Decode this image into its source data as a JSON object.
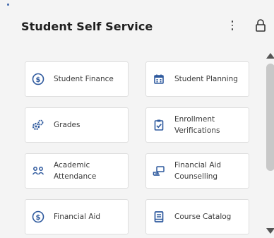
{
  "header": {
    "title": "Student Self Service",
    "menu_icon": "kebab-menu-icon",
    "lock_icon": "lock-icon"
  },
  "tiles": [
    {
      "label": "Student Finance",
      "icon": "dollar-circle-icon"
    },
    {
      "label": "Student Planning",
      "icon": "calendar-icon"
    },
    {
      "label": "Grades",
      "icon": "gears-icon"
    },
    {
      "label": "Enrollment Verifications",
      "icon": "clipboard-check-icon"
    },
    {
      "label": "Academic Attendance",
      "icon": "people-icon"
    },
    {
      "label": "Financial Aid Counselling",
      "icon": "chat-hand-icon"
    },
    {
      "label": "Financial Aid",
      "icon": "dollar-circle-icon"
    },
    {
      "label": "Course Catalog",
      "icon": "book-icon"
    }
  ],
  "colors": {
    "accent": "#2f5a9e",
    "background": "#f4f4f4",
    "tile_border": "#dedede",
    "scrollbar_thumb": "#c8c8c8"
  }
}
